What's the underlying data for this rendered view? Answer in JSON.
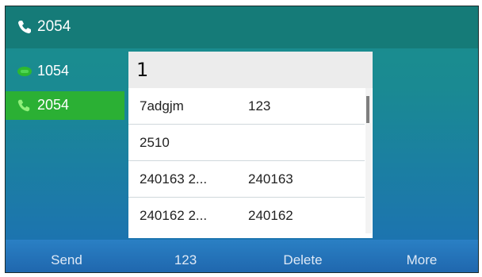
{
  "header": {
    "number": "2054"
  },
  "lines": [
    {
      "label": "1054"
    },
    {
      "label": "2054"
    }
  ],
  "search": {
    "input_value": "1"
  },
  "results": [
    {
      "name": "7adgjm",
      "number": "123"
    },
    {
      "name": "2510",
      "number": ""
    },
    {
      "name": "240163 2...",
      "number": "240163"
    },
    {
      "name": "240162 2...",
      "number": "240162"
    }
  ],
  "softkeys": [
    "Send",
    "123",
    "Delete",
    "More"
  ]
}
